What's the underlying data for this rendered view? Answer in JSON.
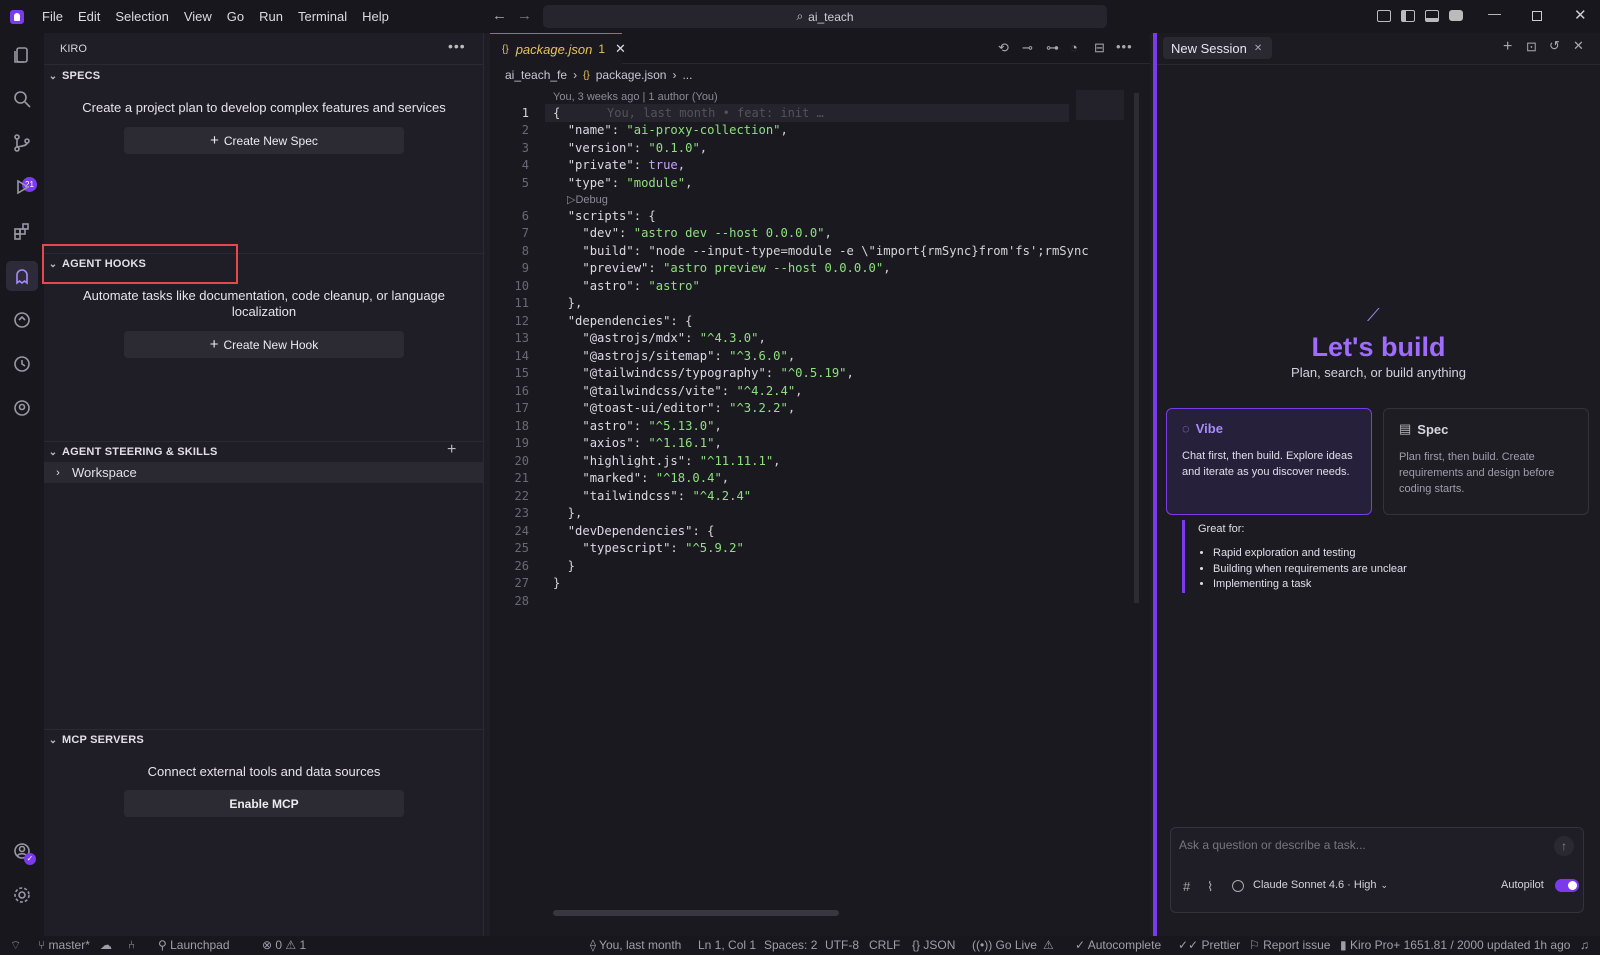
{
  "menu": [
    "File",
    "Edit",
    "Selection",
    "View",
    "Go",
    "Run",
    "Terminal",
    "Help"
  ],
  "search": {
    "text": "ai_teach"
  },
  "sidebar": {
    "title": "KIRO",
    "specs": {
      "header": "SPECS",
      "description": "Create a project plan to develop complex features and services",
      "button": "Create New Spec"
    },
    "hooks": {
      "header": "AGENT HOOKS",
      "description_line1": "Automate tasks like documentation, code cleanup, or language",
      "description_line2": "localization",
      "button": "Create New Hook"
    },
    "steering": {
      "header": "AGENT STEERING & SKILLS",
      "workspace": "Workspace"
    },
    "mcp": {
      "header": "MCP SERVERS",
      "description": "Connect external tools and data sources",
      "button": "Enable MCP"
    }
  },
  "activity": {
    "badge": "21"
  },
  "editor": {
    "tab": {
      "name": "package.json",
      "badge": "1"
    },
    "breadcrumb": [
      "ai_teach_fe",
      "package.json",
      "..."
    ],
    "blame": "You, 3 weeks ago | 1 author (You)",
    "inline_blame": "You, last month • feat: init …",
    "debug_lens": "Debug",
    "lines": [
      {
        "n": "1",
        "t": "{"
      },
      {
        "n": "2",
        "t": "  \"name\": \"ai-proxy-collection\","
      },
      {
        "n": "3",
        "t": "  \"version\": \"0.1.0\","
      },
      {
        "n": "4",
        "t": "  \"private\": true,"
      },
      {
        "n": "5",
        "t": "  \"type\": \"module\","
      },
      {
        "n": "6",
        "t": "  \"scripts\": {"
      },
      {
        "n": "7",
        "t": "    \"dev\": \"astro dev --host 0.0.0.0\","
      },
      {
        "n": "8",
        "t": "    \"build\": \"node --input-type=module -e \\\"import{rmSync}from'fs';rmSync"
      },
      {
        "n": "9",
        "t": "    \"preview\": \"astro preview --host 0.0.0.0\","
      },
      {
        "n": "10",
        "t": "    \"astro\": \"astro\""
      },
      {
        "n": "11",
        "t": "  },"
      },
      {
        "n": "12",
        "t": "  \"dependencies\": {"
      },
      {
        "n": "13",
        "t": "    \"@astrojs/mdx\": \"^4.3.0\","
      },
      {
        "n": "14",
        "t": "    \"@astrojs/sitemap\": \"^3.6.0\","
      },
      {
        "n": "15",
        "t": "    \"@tailwindcss/typography\": \"^0.5.19\","
      },
      {
        "n": "16",
        "t": "    \"@tailwindcss/vite\": \"^4.2.4\","
      },
      {
        "n": "17",
        "t": "    \"@toast-ui/editor\": \"^3.2.2\","
      },
      {
        "n": "18",
        "t": "    \"astro\": \"^5.13.0\","
      },
      {
        "n": "19",
        "t": "    \"axios\": \"^1.16.1\","
      },
      {
        "n": "20",
        "t": "    \"highlight.js\": \"^11.11.1\","
      },
      {
        "n": "21",
        "t": "    \"marked\": \"^18.0.4\","
      },
      {
        "n": "22",
        "t": "    \"tailwindcss\": \"^4.2.4\""
      },
      {
        "n": "23",
        "t": "  },"
      },
      {
        "n": "24",
        "t": "  \"devDependencies\": {"
      },
      {
        "n": "25",
        "t": "    \"typescript\": \"^5.9.2\""
      },
      {
        "n": "26",
        "t": "  }"
      },
      {
        "n": "27",
        "t": "}"
      },
      {
        "n": "28",
        "t": ""
      }
    ]
  },
  "chat": {
    "tab": "New Session",
    "heading": "Let's build",
    "subheading": "Plan, search, or build anything",
    "vibe": {
      "title": "Vibe",
      "desc": "Chat first, then build. Explore ideas and iterate as you discover needs."
    },
    "spec": {
      "title": "Spec",
      "desc": "Plan first, then build. Create requirements and design before coding starts."
    },
    "great_for": "Great for:",
    "bullets": [
      "Rapid exploration and testing",
      "Building when requirements are unclear",
      "Implementing a task"
    ],
    "input_placeholder": "Ask a question or describe a task...",
    "model": "Claude Sonnet 4.6 · High",
    "autopilot": "Autopilot"
  },
  "status": {
    "branch": "master*",
    "launchpad": "Launchpad",
    "errors": "0",
    "warnings": "1",
    "blame": "You, last month",
    "position": "Ln 1, Col 1",
    "spaces": "Spaces: 2",
    "encoding": "UTF-8",
    "eol": "CRLF",
    "lang": "JSON",
    "golive": "Go Live",
    "autocomplete": "Autocomplete",
    "prettier": "Prettier",
    "report": "Report issue",
    "plan": "Kiro Pro+ 1651.81 / 2000 updated 1h ago"
  },
  "colors": {
    "accent": "#8b5cf6",
    "highlight_box": "#e5484d"
  }
}
